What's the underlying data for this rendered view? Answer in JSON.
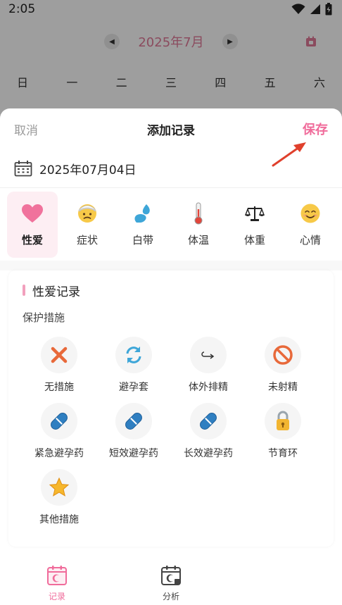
{
  "status_bar": {
    "time": "2:05"
  },
  "calendar": {
    "month": "2025年7月",
    "weekdays": [
      "日",
      "一",
      "二",
      "三",
      "四",
      "五",
      "六"
    ]
  },
  "sheet": {
    "cancel_label": "取消",
    "title": "添加记录",
    "save_label": "保存",
    "date": "2025年07月04日"
  },
  "categories": [
    {
      "label": "性爱",
      "icon": "heart-icon",
      "active": true
    },
    {
      "label": "症状",
      "icon": "sick-face-icon",
      "active": false
    },
    {
      "label": "白带",
      "icon": "droplet-icon",
      "active": false
    },
    {
      "label": "体温",
      "icon": "thermometer-icon",
      "active": false
    },
    {
      "label": "体重",
      "icon": "scale-icon",
      "active": false
    },
    {
      "label": "心情",
      "icon": "smile-face-icon",
      "active": false
    }
  ],
  "record_card": {
    "title": "性爱记录",
    "subtitle": "保护措施",
    "options": [
      {
        "label": "无措施",
        "icon": "cross-icon"
      },
      {
        "label": "避孕套",
        "icon": "refresh-icon"
      },
      {
        "label": "体外排精",
        "icon": "hook-arrow-icon"
      },
      {
        "label": "未射精",
        "icon": "prohibited-icon"
      },
      {
        "label": "紧急避孕药",
        "icon": "pill-icon"
      },
      {
        "label": "短效避孕药",
        "icon": "pill-icon"
      },
      {
        "label": "长效避孕药",
        "icon": "pill-icon"
      },
      {
        "label": "节育环",
        "icon": "lock-icon"
      },
      {
        "label": "其他措施",
        "icon": "star-icon"
      }
    ]
  },
  "bottom_nav": [
    {
      "label": "记录",
      "icon": "record-calendar-icon",
      "active": true
    },
    {
      "label": "分析",
      "icon": "analysis-calendar-icon",
      "active": false
    }
  ],
  "colors": {
    "accent": "#f06c9b",
    "month_text": "#e07a98",
    "active_tab_bg": "#fdeef3",
    "arrow_red": "#e0402c"
  }
}
